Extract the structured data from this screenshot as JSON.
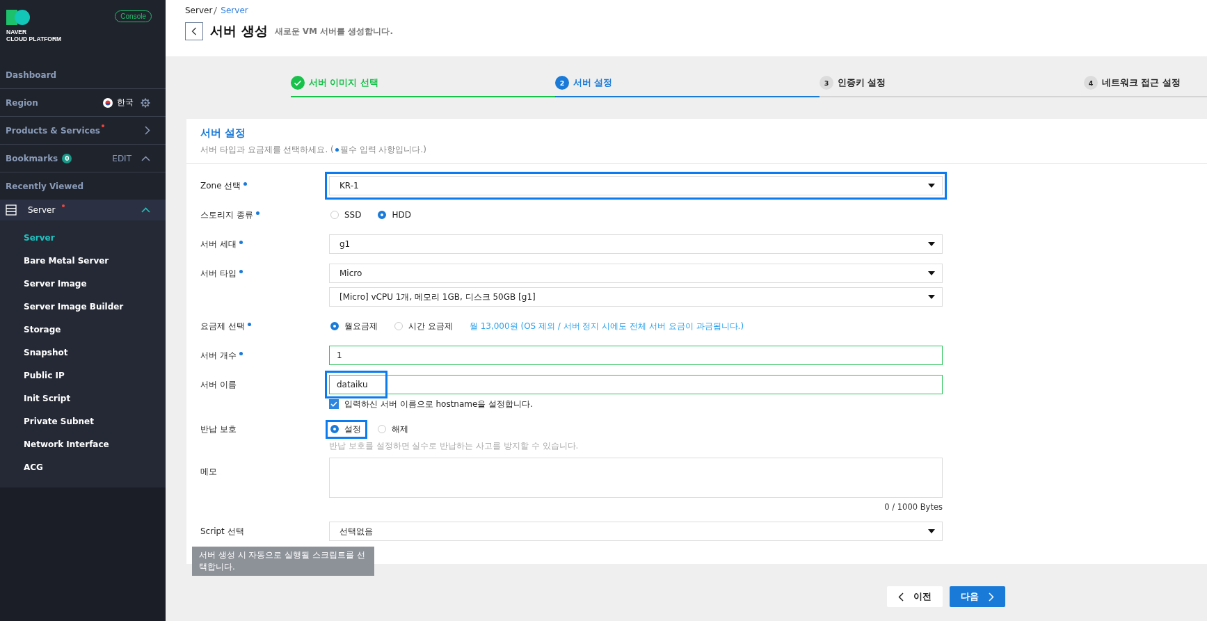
{
  "sidebar": {
    "logo": {
      "line1": "NAVER",
      "line2": "CLOUD PLATFORM"
    },
    "console": "Console",
    "menu": [
      {
        "kind": "link",
        "label": "Dashboard"
      },
      {
        "kind": "region",
        "label": "Region",
        "value": "한국"
      },
      {
        "kind": "arrow",
        "label": "Products & Services",
        "dot": true
      },
      {
        "kind": "bookmarks",
        "label": "Bookmarks",
        "count": "0",
        "action": "EDIT"
      },
      {
        "kind": "link",
        "label": "Recently Viewed"
      }
    ],
    "section": {
      "label": "Server",
      "dot": true,
      "expanded": true,
      "items": [
        {
          "label": "Server",
          "selected": true
        },
        {
          "label": "Bare Metal Server",
          "selected": false
        },
        {
          "label": "Server Image",
          "selected": false
        },
        {
          "label": "Server Image Builder",
          "selected": false
        },
        {
          "label": "Storage",
          "selected": false
        },
        {
          "label": "Snapshot",
          "selected": false
        },
        {
          "label": "Public IP",
          "selected": false
        },
        {
          "label": "Init Script",
          "selected": false
        },
        {
          "label": "Private Subnet",
          "selected": false
        },
        {
          "label": "Network Interface",
          "selected": false
        },
        {
          "label": "ACG",
          "selected": false
        }
      ]
    }
  },
  "breadcrumb": [
    {
      "label": "Server",
      "link": false
    },
    {
      "label": "Server",
      "link": true
    }
  ],
  "header": {
    "title": "서버 생성",
    "subtitle": "새로운 VM 서버를 생성합니다."
  },
  "steps": [
    {
      "label": "서버 이미지 선택",
      "done": true,
      "selected": false
    },
    {
      "number": "2",
      "label": "서버 설정",
      "done": false,
      "selected": true
    },
    {
      "number": "3",
      "label": "인증키 설정",
      "done": false,
      "selected": false
    },
    {
      "number": "4",
      "label": "네트워크 접근 설정",
      "done": false,
      "selected": false
    }
  ],
  "card": {
    "title": "서버 설정",
    "hint_before": "서버 타입과 요금제를 선택하세요. (",
    "hint_after": "필수 입력 사항입니다.)",
    "rows": [
      {
        "label": "Zone 선택",
        "required": true,
        "controls": [
          {
            "kind": "select",
            "value": "KR-1",
            "highlighted": true
          }
        ]
      },
      {
        "label": "스토리지 종류",
        "required": true,
        "controls": [
          {
            "kind": "radios",
            "options": [
              {
                "label": "SSD",
                "selected": false
              },
              {
                "label": "HDD",
                "selected": true
              }
            ]
          }
        ]
      },
      {
        "label": "서버 세대",
        "required": true,
        "controls": [
          {
            "kind": "select",
            "value": "g1"
          }
        ]
      },
      {
        "label": "서버 타입",
        "required": true,
        "controls": [
          {
            "kind": "select",
            "value": "Micro"
          },
          {
            "kind": "select",
            "value": "[Micro] vCPU 1개, 메모리 1GB, 디스크 50GB [g1]"
          }
        ]
      },
      {
        "label": "요금제 선택",
        "required": true,
        "controls": [
          {
            "kind": "radios",
            "options": [
              {
                "label": "월요금제",
                "selected": true
              },
              {
                "label": "시간 요금제",
                "selected": false
              }
            ],
            "note": "월 13,000원 (OS 제외 / 서버 정지 시에도 전체 서버 요금이 과금됩니다.)"
          }
        ]
      },
      {
        "label": "서버 개수",
        "required": true,
        "controls": [
          {
            "kind": "input",
            "value": "1",
            "valid": true
          }
        ]
      },
      {
        "label": "서버 이름",
        "required": false,
        "controls": [
          {
            "kind": "input",
            "value": "dataiku",
            "valid": true,
            "highlighted": true
          },
          {
            "kind": "checkbox",
            "label": "입력하신 서버 이름으로 hostname을 설정합니다.",
            "checked": true
          }
        ]
      },
      {
        "label": "반납 보호",
        "required": false,
        "controls": [
          {
            "kind": "radios",
            "options": [
              {
                "label": "설정",
                "selected": true,
                "highlighted": true
              },
              {
                "label": "해제",
                "selected": false
              }
            ]
          },
          {
            "kind": "hint",
            "text": "반납 보호를 설정하면 실수로 반납하는 사고를 방지할 수 있습니다."
          }
        ]
      },
      {
        "label": "메모",
        "required": false,
        "controls": [
          {
            "kind": "textarea",
            "counter": "0 / 1000 Bytes"
          }
        ]
      },
      {
        "label": "Script 선택",
        "required": false,
        "controls": [
          {
            "kind": "select",
            "value": "선택없음"
          }
        ],
        "tooltip": "서버 생성 시 자동으로 실행될 스크립트를 선택합니다."
      }
    ]
  },
  "footer": {
    "prev": "이전",
    "next": "다음"
  }
}
